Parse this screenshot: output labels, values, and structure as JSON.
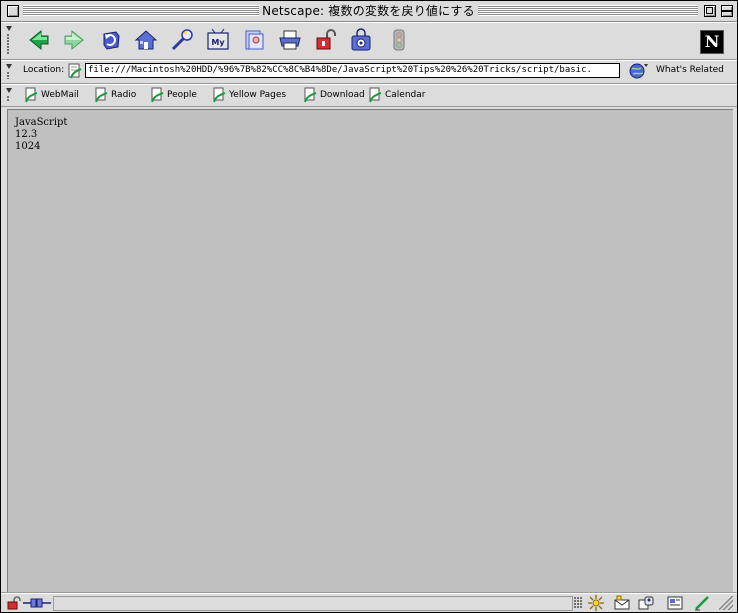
{
  "window": {
    "title": "Netscape: 複数の変数を戻り値にする"
  },
  "navbar": {
    "buttons": [
      {
        "name": "Back",
        "icon": "back-arrow-icon"
      },
      {
        "name": "Forward",
        "icon": "forward-arrow-icon"
      },
      {
        "name": "Reload",
        "icon": "reload-icon"
      },
      {
        "name": "Home",
        "icon": "home-icon"
      },
      {
        "name": "Search",
        "icon": "search-icon"
      },
      {
        "name": "My Netscape",
        "icon": "my-netscape-icon"
      },
      {
        "name": "Images",
        "icon": "images-icon"
      },
      {
        "name": "Print",
        "icon": "print-icon"
      },
      {
        "name": "Security",
        "icon": "lock-open-icon"
      },
      {
        "name": "Shop",
        "icon": "shopping-bag-icon"
      },
      {
        "name": "Stop",
        "icon": "stop-icon"
      }
    ]
  },
  "location": {
    "label": "Location:",
    "url": "file:///Macintosh%20HDD/%96%7B%82%CC%8C%B4%8De/JavaScript%20Tips%20%26%20Tricks/script/basic.",
    "related_label": "What's Related"
  },
  "personal_toolbar": {
    "items": [
      {
        "label": "WebMail"
      },
      {
        "label": "Radio"
      },
      {
        "label": "People"
      },
      {
        "label": "Yellow Pages"
      },
      {
        "label": "Download"
      },
      {
        "label": "Calendar"
      }
    ]
  },
  "content": {
    "lines": [
      "JavaScript",
      "12.3",
      "1024"
    ]
  },
  "status": {
    "text": ""
  },
  "colors": {
    "chrome": "#dcdcdc",
    "content_background": "#c0c0c0",
    "nav_green": "#1a9a3a"
  }
}
